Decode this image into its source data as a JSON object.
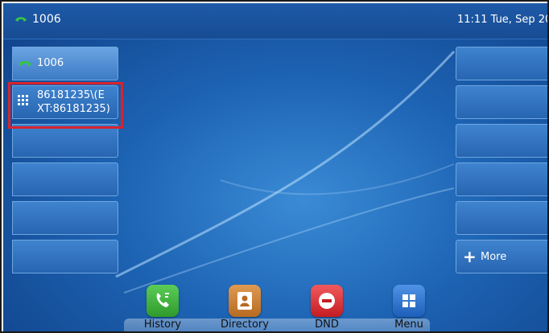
{
  "status_bar": {
    "account": "1006",
    "datetime": "11:11 Tue, Sep 20"
  },
  "line_keys_left": [
    {
      "label": "1006",
      "icon": "handset-icon"
    },
    {
      "label_line1": "86181235\\(E",
      "label_line2": "XT:86181235)",
      "icon": "keypad-icon"
    },
    {
      "label": ""
    },
    {
      "label": ""
    },
    {
      "label": ""
    },
    {
      "label": ""
    }
  ],
  "line_keys_right": [
    {
      "label": ""
    },
    {
      "label": ""
    },
    {
      "label": ""
    },
    {
      "label": ""
    },
    {
      "label": ""
    },
    {
      "label": "More",
      "icon": "plus-icon"
    }
  ],
  "softkeys": [
    {
      "label": "History",
      "color": "#3cab3a"
    },
    {
      "label": "Directory",
      "color": "#c77a2f"
    },
    {
      "label": "DND",
      "color": "#d9262b"
    },
    {
      "label": "Menu",
      "color": "#2b73d1"
    }
  ]
}
